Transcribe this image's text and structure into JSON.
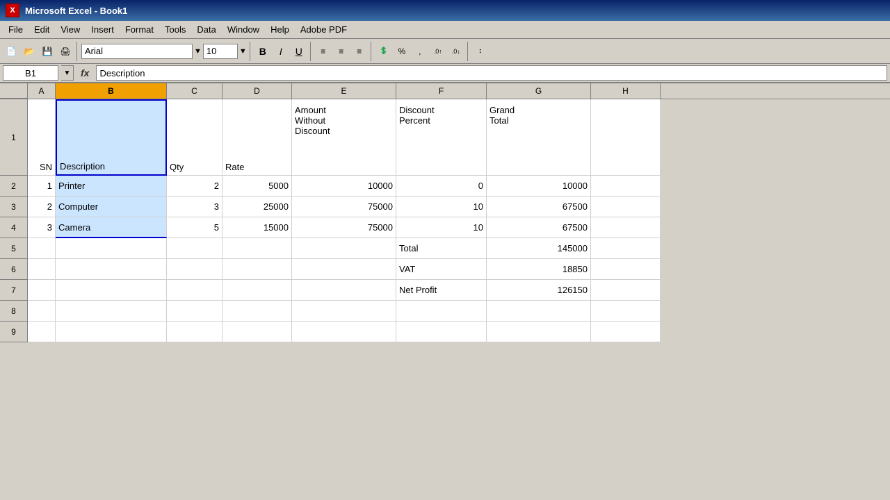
{
  "titleBar": {
    "icon": "X",
    "title": "Microsoft Excel - Book1"
  },
  "menuBar": {
    "items": [
      "File",
      "Edit",
      "View",
      "Insert",
      "Format",
      "Tools",
      "Data",
      "Window",
      "Help",
      "Adobe PDF"
    ]
  },
  "toolbar": {
    "font": "Arial",
    "fontSize": "10",
    "buttons": [
      "B",
      "I",
      "U",
      "≡",
      "≡",
      "≡",
      "✦",
      "%",
      ",",
      ".0",
      ".00"
    ]
  },
  "formulaBar": {
    "cellRef": "B1",
    "formula": "Description"
  },
  "columns": {
    "headers": [
      "A",
      "B",
      "C",
      "D",
      "E",
      "F",
      "G",
      "H"
    ],
    "widths": [
      "w-a",
      "w-b",
      "w-c",
      "w-d",
      "w-e",
      "w-f",
      "w-g",
      "w-h"
    ]
  },
  "rows": {
    "headers": [
      "1",
      "2",
      "3",
      "4",
      "5",
      "6",
      "7",
      "8",
      "9"
    ]
  },
  "spreadsheet": {
    "row1": {
      "A": "SN",
      "B": "Description",
      "C": "Qty",
      "D": "Rate",
      "E": "Amount\nWithout\nDiscount",
      "F": "Discount\nPercent",
      "G": "Grand\nTotal",
      "H": ""
    },
    "row2": {
      "A": "1",
      "B": "Printer",
      "C": "2",
      "D": "5000",
      "E": "10000",
      "F": "0",
      "G": "10000",
      "H": ""
    },
    "row3": {
      "A": "2",
      "B": "Computer",
      "C": "3",
      "D": "25000",
      "E": "75000",
      "F": "10",
      "G": "67500",
      "H": ""
    },
    "row4": {
      "A": "3",
      "B": "Camera",
      "C": "5",
      "D": "15000",
      "E": "75000",
      "F": "10",
      "G": "67500",
      "H": ""
    },
    "row5": {
      "A": "",
      "B": "",
      "C": "",
      "D": "",
      "E": "",
      "F": "Total",
      "G": "145000",
      "H": ""
    },
    "row6": {
      "A": "",
      "B": "",
      "C": "",
      "D": "",
      "E": "",
      "F": "VAT",
      "G": "18850",
      "H": ""
    },
    "row7": {
      "A": "",
      "B": "",
      "C": "",
      "D": "",
      "E": "",
      "F": "Net Profit",
      "G": "126150",
      "H": ""
    },
    "row8": {
      "A": "",
      "B": "",
      "C": "",
      "D": "",
      "E": "",
      "F": "",
      "G": "",
      "H": ""
    },
    "row9": {
      "A": "",
      "B": "",
      "C": "",
      "D": "",
      "E": "",
      "F": "",
      "G": "",
      "H": ""
    }
  },
  "colors": {
    "selectedColHeader": "#f0a000",
    "selectedCellBorder": "#0000cc",
    "highlightedCell": "#cce5ff"
  }
}
